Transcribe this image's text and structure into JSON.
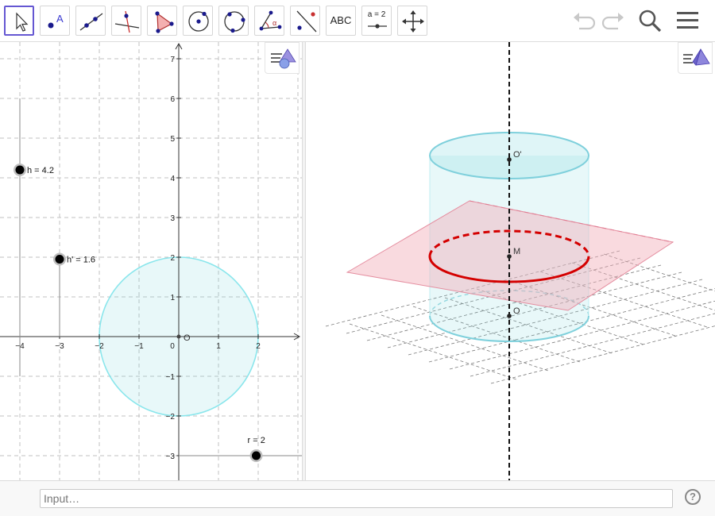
{
  "toolbar": {
    "tools": [
      {
        "name": "Move",
        "icon": "arrow-cursor-icon"
      },
      {
        "name": "Point",
        "icon": "point-icon",
        "glyph": "A"
      },
      {
        "name": "Line",
        "icon": "line-icon"
      },
      {
        "name": "Perpendicular Line",
        "icon": "perpendicular-line-icon"
      },
      {
        "name": "Polygon",
        "icon": "polygon-icon"
      },
      {
        "name": "Circle with Center through Point",
        "icon": "circle-center-point-icon"
      },
      {
        "name": "Circle through 3 Points",
        "icon": "circle-three-points-icon"
      },
      {
        "name": "Angle",
        "icon": "angle-icon",
        "glyph": "α"
      },
      {
        "name": "Reflect about Line",
        "icon": "reflect-line-icon"
      },
      {
        "name": "Text",
        "icon": "text-icon",
        "glyph": "ABC"
      },
      {
        "name": "Slider",
        "icon": "slider-icon",
        "glyph": "a = 2"
      },
      {
        "name": "Move Graphics View",
        "icon": "move-view-icon"
      }
    ],
    "right": [
      "undo-icon",
      "redo-icon",
      "search-icon",
      "menu-icon"
    ]
  },
  "graphics2d": {
    "x_ticks": [
      "−4",
      "−3",
      "−2",
      "−1",
      "0",
      "1",
      "2"
    ],
    "y_ticks": [
      "7",
      "6",
      "5",
      "4",
      "3",
      "2",
      "1",
      "−1",
      "−2",
      "−3"
    ],
    "origin_label": "O",
    "sliders": [
      {
        "name": "h",
        "value": 4.2,
        "label": "h = 4.2"
      },
      {
        "name": "h'",
        "value": 1.6,
        "label": "h' = 1.6"
      },
      {
        "name": "r",
        "value": 2,
        "label": "r = 2"
      }
    ],
    "circle": {
      "center": [
        0,
        0
      ],
      "radius": 2
    }
  },
  "graphics3d": {
    "points": [
      {
        "label": "O'"
      },
      {
        "label": "M"
      },
      {
        "label": "O"
      }
    ]
  },
  "colors": {
    "accent": "#6557d2",
    "cylinder": "#7fd8e0",
    "plane": "#f2aeb9",
    "section": "#d40000",
    "grid": "#8a8a8a"
  },
  "input": {
    "placeholder": "Input…"
  },
  "help": {
    "label": "?"
  }
}
